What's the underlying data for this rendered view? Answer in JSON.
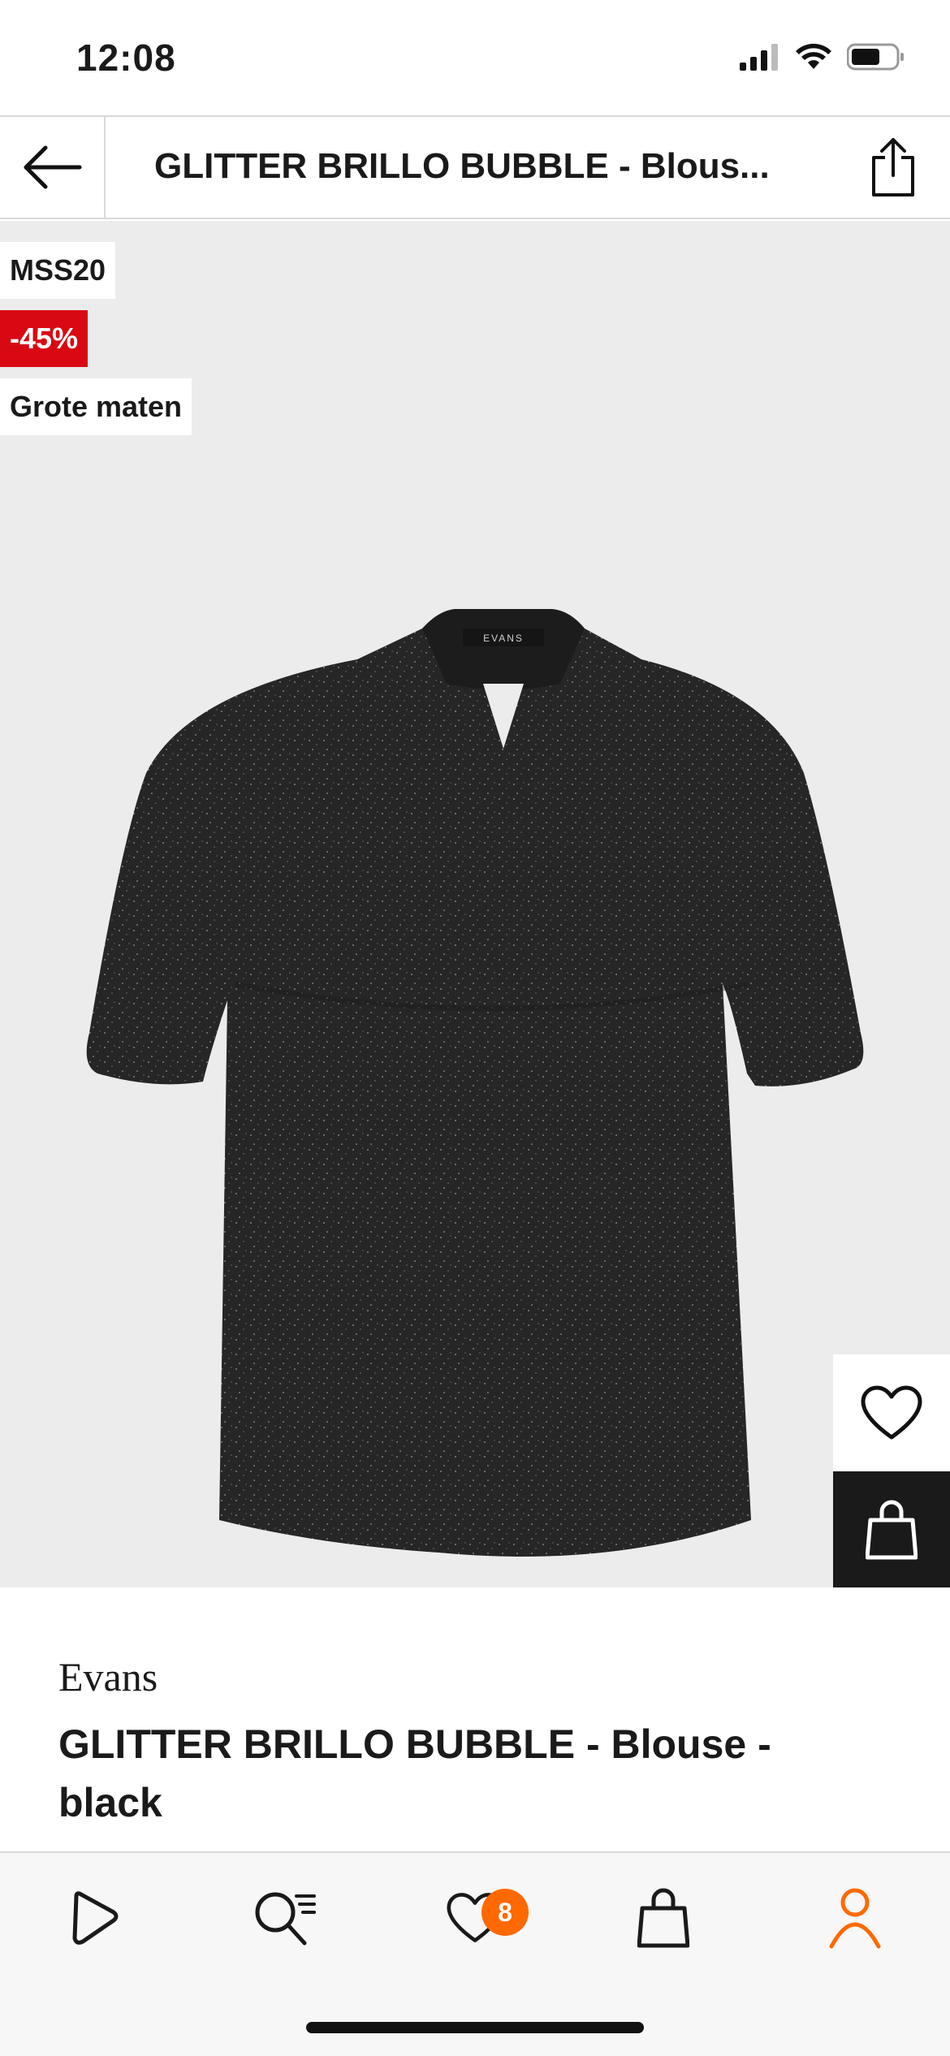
{
  "status_bar": {
    "time": "12:08"
  },
  "header": {
    "title": "GLITTER BRILLO BUBBLE - Blous..."
  },
  "badges": {
    "code": "MSS20",
    "discount": "-45%",
    "size_label": "Grote maten"
  },
  "garment_label": "EVANS",
  "carousel": {
    "progress": 0.33
  },
  "product": {
    "brand": "Evans",
    "name": "GLITTER BRILLO BUBBLE - Blouse - black"
  },
  "tab_bar": {
    "items": [
      "home-icon",
      "search-list-icon",
      "heart-icon",
      "bag-icon",
      "profile-icon"
    ],
    "wishlist_count": "8",
    "active_color": "#ff6900"
  },
  "colors": {
    "sale_red": "#d90913",
    "accent_orange": "#ff6900"
  }
}
